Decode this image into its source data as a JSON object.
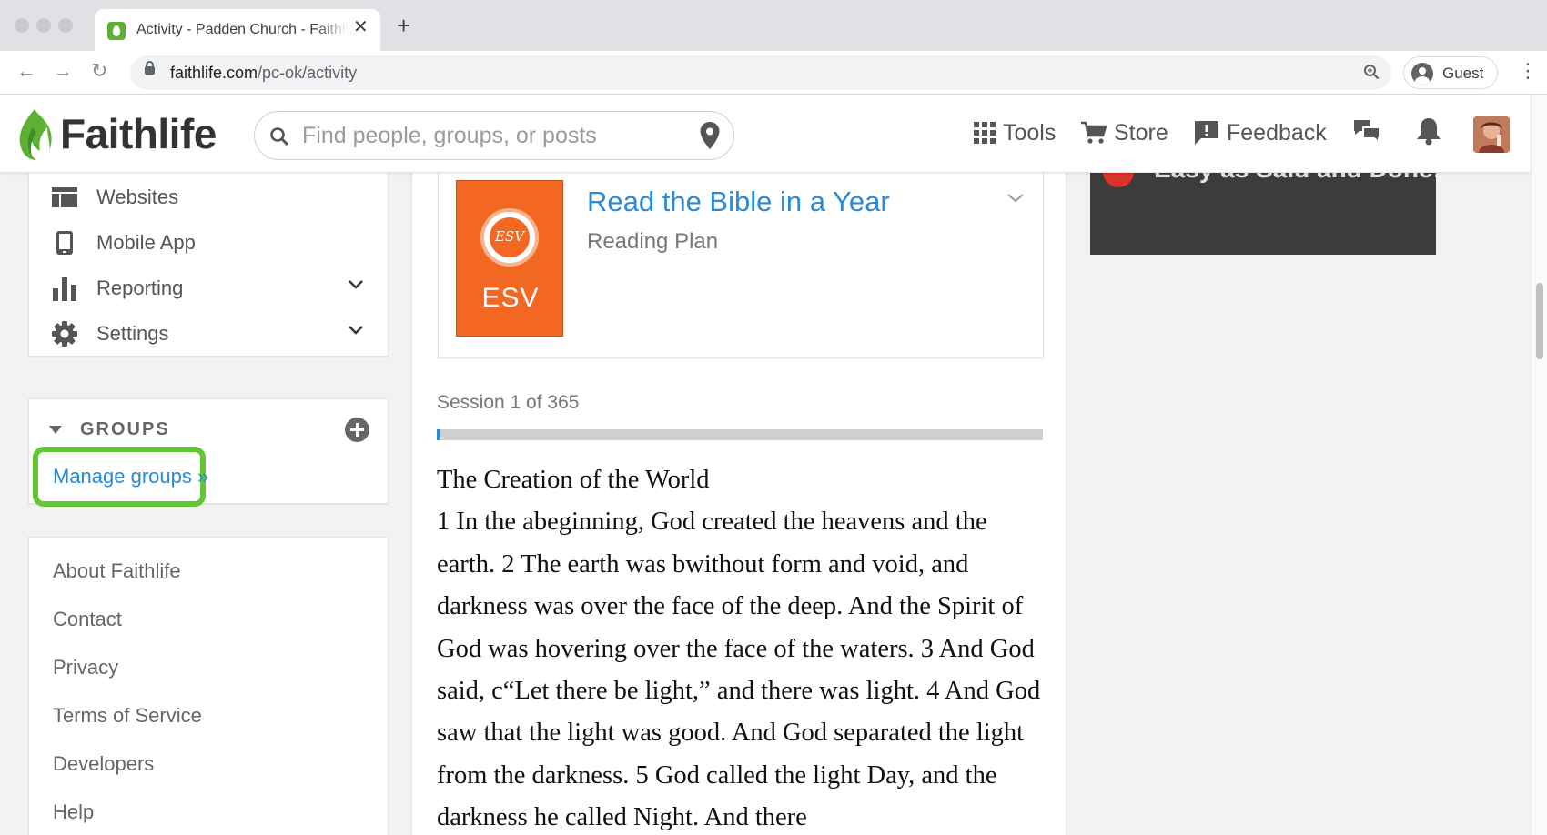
{
  "browser": {
    "tab_title": "Activity - Padden Church - Faithlife",
    "url_host": "faithlife.com",
    "url_path": "/pc-ok/activity",
    "profile_label": "Guest"
  },
  "header": {
    "logo_text": "Faithlife",
    "search_placeholder": "Find people, groups, or posts",
    "nav": {
      "tools": "Tools",
      "store": "Store",
      "feedback": "Feedback"
    }
  },
  "sidebar": {
    "nav_items": [
      {
        "label": "Websites",
        "icon": "websites-icon"
      },
      {
        "label": "Mobile App",
        "icon": "mobile-icon"
      },
      {
        "label": "Reporting",
        "icon": "bar-chart-icon"
      },
      {
        "label": "Settings",
        "icon": "gear-icon"
      }
    ],
    "groups_title": "GROUPS",
    "manage_groups": "Manage groups »",
    "footer_links": [
      "About Faithlife",
      "Contact",
      "Privacy",
      "Terms of Service",
      "Developers",
      "Help"
    ]
  },
  "plan": {
    "cover_label": "ESV",
    "cover_seal": "ESV",
    "title": "Read the Bible in a Year",
    "subtitle": "Reading Plan",
    "session": "Session 1 of 365",
    "progress_fraction": 0.003
  },
  "reading": {
    "heading": "The Creation of the World",
    "text": "1 In the abeginning, God created the heavens and the earth. 2 The earth was bwithout form and void, and darkness was over the face of the deep. And the Spirit of God was hovering over the face of the waters. 3 And God said, c“Let there be light,” and there was light. 4 And God saw that the light was good. And God separated the light from the darkness. 5 God called the light Day, and the darkness he called Night. And there"
  },
  "video": {
    "caption": "Easy as Said and Done!"
  },
  "colors": {
    "brand_green": "#5cb135",
    "link_blue": "#2a8ad4",
    "highlight_green": "#63c733",
    "esv_orange": "#f26722"
  }
}
